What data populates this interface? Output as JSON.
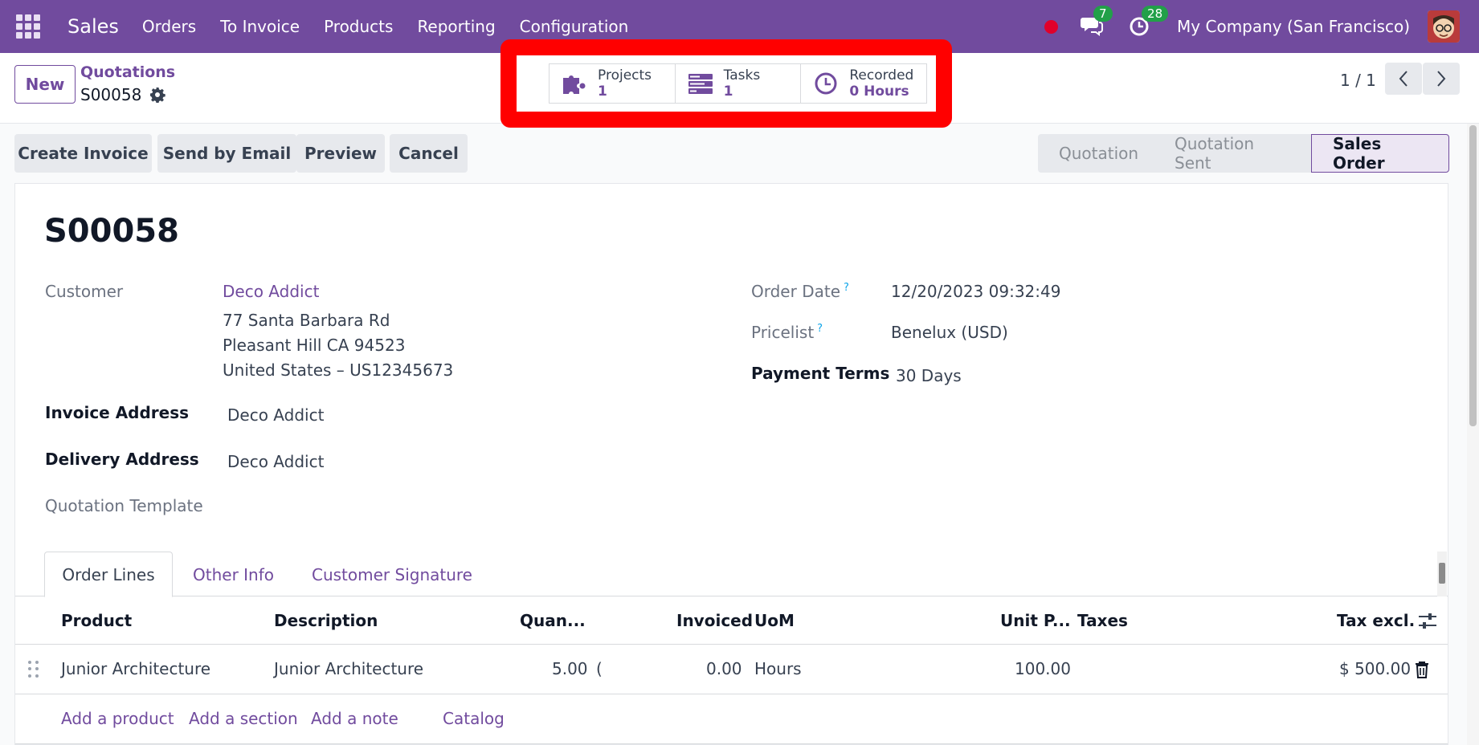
{
  "navbar": {
    "app_name": "Sales",
    "menu": [
      "Orders",
      "To Invoice",
      "Products",
      "Reporting",
      "Configuration"
    ],
    "messages_count": "7",
    "activities_count": "28",
    "company": "My Company (San Francisco)",
    "brand_color": "#714b9e"
  },
  "control_panel": {
    "new_label": "New",
    "breadcrumb_parent": "Quotations",
    "breadcrumb_current": "S00058",
    "pager": "1 / 1"
  },
  "smart_buttons": [
    {
      "label": "Projects",
      "value": "1",
      "icon": "puzzle-icon"
    },
    {
      "label": "Tasks",
      "value": "1",
      "icon": "tasks-icon"
    },
    {
      "label": "Recorded",
      "value": "0 Hours",
      "icon": "clock-icon"
    }
  ],
  "actions": [
    "Create Invoice",
    "Send by Email",
    "Preview",
    "Cancel"
  ],
  "status_stages": [
    "Quotation",
    "Quotation Sent",
    "Sales Order"
  ],
  "status_current": "Sales Order",
  "form": {
    "title": "S00058",
    "customer_label": "Customer",
    "customer_name": "Deco Addict",
    "customer_address": [
      "77 Santa Barbara Rd",
      "Pleasant Hill CA 94523",
      "United States – US12345673"
    ],
    "invoice_address_label": "Invoice Address",
    "invoice_address": "Deco Addict",
    "delivery_address_label": "Delivery Address",
    "delivery_address": "Deco Addict",
    "quotation_template_label": "Quotation Template",
    "order_date_label": "Order Date",
    "order_date": "12/20/2023 09:32:49",
    "pricelist_label": "Pricelist",
    "pricelist": "Benelux (USD)",
    "payment_terms_label": "Payment Terms",
    "payment_terms": "30 Days",
    "help_mark": "?"
  },
  "tabs": [
    "Order Lines",
    "Other Info",
    "Customer Signature"
  ],
  "table": {
    "columns": [
      "Product",
      "Description",
      "Quan...",
      "Invoiced",
      "UoM",
      "Unit P...",
      "Taxes",
      "Tax excl."
    ],
    "rows": [
      {
        "product": "Junior Architecture",
        "description": "Junior Architecture",
        "quantity": "5.00",
        "delivered_clip": "(",
        "invoiced": "0.00",
        "uom": "Hours",
        "unit_price": "100.00",
        "taxes": "",
        "subtotal": "$ 500.00"
      }
    ],
    "add_links": [
      "Add a product",
      "Add a section",
      "Add a note",
      "Catalog"
    ]
  }
}
